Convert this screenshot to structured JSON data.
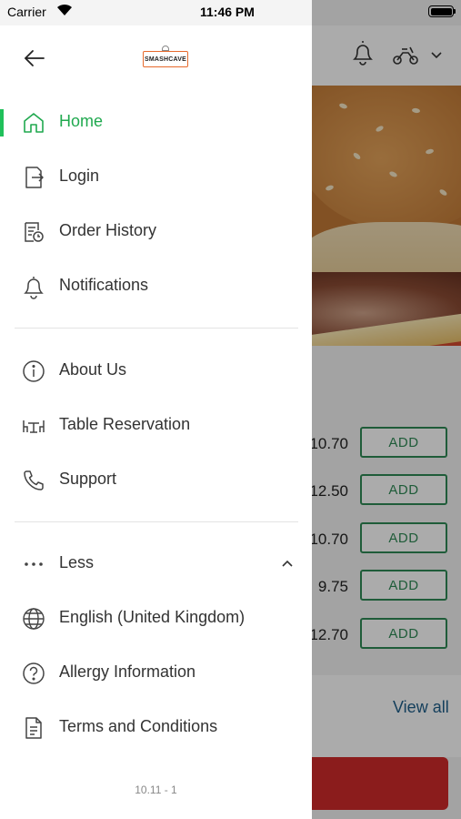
{
  "status_bar": {
    "carrier": "Carrier",
    "time": "11:46 PM"
  },
  "logo": {
    "text": "SMASHCAVE"
  },
  "menu": {
    "primary": [
      {
        "label": "Home",
        "icon": "home-icon",
        "active": true
      },
      {
        "label": "Login",
        "icon": "login-icon"
      },
      {
        "label": "Order History",
        "icon": "order-history-icon"
      },
      {
        "label": "Notifications",
        "icon": "bell-icon"
      }
    ],
    "secondary": [
      {
        "label": "About Us",
        "icon": "info-icon"
      },
      {
        "label": "Table Reservation",
        "icon": "table-icon"
      },
      {
        "label": "Support",
        "icon": "phone-icon"
      }
    ],
    "more_toggle": {
      "label": "Less",
      "icon": "dots-icon",
      "chevron": "chevron-up-icon"
    },
    "extra": [
      {
        "label": "English (United Kingdom)",
        "icon": "globe-icon"
      },
      {
        "label": "Allergy Information",
        "icon": "question-icon"
      },
      {
        "label": "Terms and Conditions",
        "icon": "document-icon"
      }
    ]
  },
  "version": "10.11 - 1",
  "background": {
    "prices": [
      "10.70",
      "12.50",
      "10.70",
      "9.75",
      "12.70"
    ],
    "add_label": "ADD",
    "view_all": "View all"
  },
  "colors": {
    "active_green": "#20a94f",
    "add_border": "#2f8a55",
    "cta_red": "#d02a2a",
    "logo_orange": "#e66a2c",
    "link_blue": "#1f5e8a"
  }
}
